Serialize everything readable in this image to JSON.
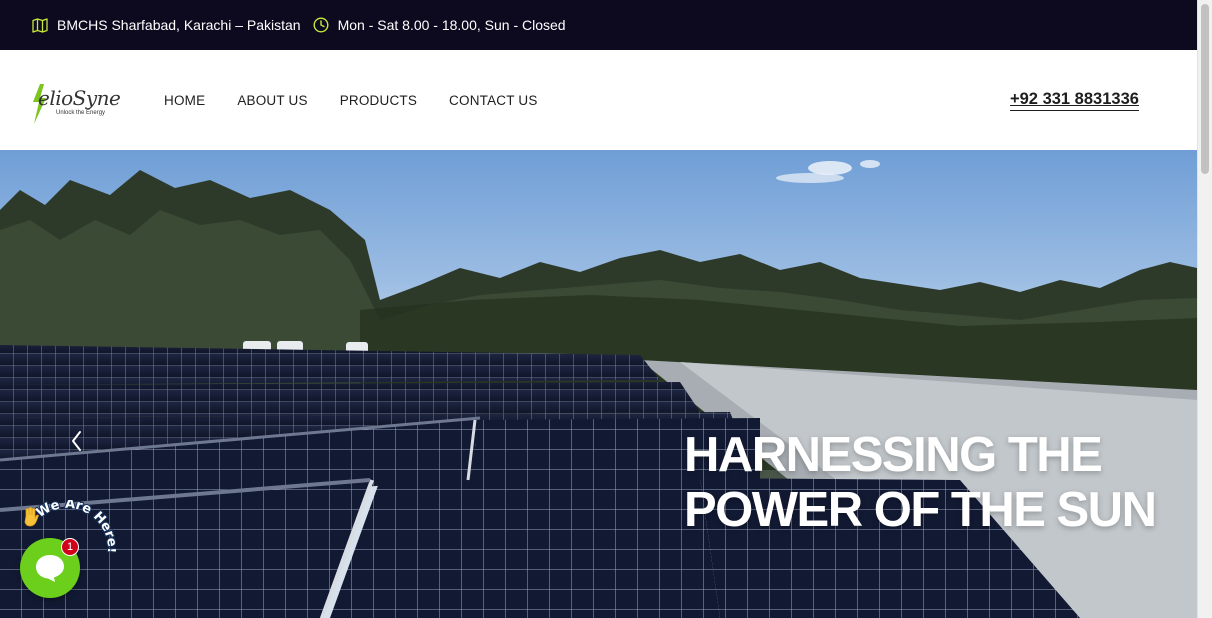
{
  "topbar": {
    "address": "BMCHS Sharfabad, Karachi – Pakistan",
    "hours": "Mon - Sat 8.00 - 18.00, Sun - Closed",
    "address_icon": "map-icon",
    "hours_icon": "clock-icon",
    "icon_color": "#c5e83a"
  },
  "logo": {
    "brand": "elioSyne",
    "tagline": "Unlock the Energy"
  },
  "nav": {
    "items": [
      {
        "label": "HOME"
      },
      {
        "label": "ABOUT US"
      },
      {
        "label": "PRODUCTS"
      },
      {
        "label": "CONTACT US"
      }
    ]
  },
  "header": {
    "phone": "+92 331 8831336"
  },
  "hero": {
    "title_line1": "HARNESSING THE",
    "title_line2": "POWER OF THE SUN"
  },
  "chat": {
    "badge_count": "1",
    "curved_text": "We Are Here!",
    "brand_color": "#6bcf1b"
  }
}
